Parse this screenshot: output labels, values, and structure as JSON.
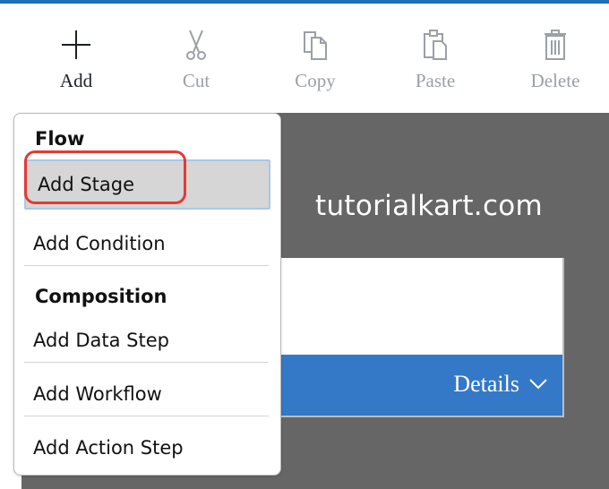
{
  "toolbar": {
    "items": [
      {
        "label": "Add",
        "icon": "plus-icon",
        "active": true
      },
      {
        "label": "Cut",
        "icon": "scissors-icon",
        "active": false
      },
      {
        "label": "Copy",
        "icon": "copy-icon",
        "active": false
      },
      {
        "label": "Paste",
        "icon": "clipboard-icon",
        "active": false
      },
      {
        "label": "Delete",
        "icon": "trash-icon",
        "active": false
      }
    ]
  },
  "canvas": {
    "watermark": "tutorialkart.com",
    "card": {
      "footer_label": "Details",
      "footer_icon": "chevron-down-icon"
    }
  },
  "menu": {
    "sections": [
      {
        "title": "Flow",
        "items": [
          "Add Stage",
          "Add Condition"
        ]
      },
      {
        "title": "Composition",
        "items": [
          "Add Data Step",
          "Add Workflow",
          "Add Action Step"
        ]
      }
    ],
    "selected_item": "Add Stage"
  },
  "colors": {
    "top_accent": "#1f6fb5",
    "canvas_bg": "#666666",
    "card_footer": "#3478c8",
    "highlight_ring": "#e53935",
    "selected_item_bg": "#d6d6d6"
  }
}
